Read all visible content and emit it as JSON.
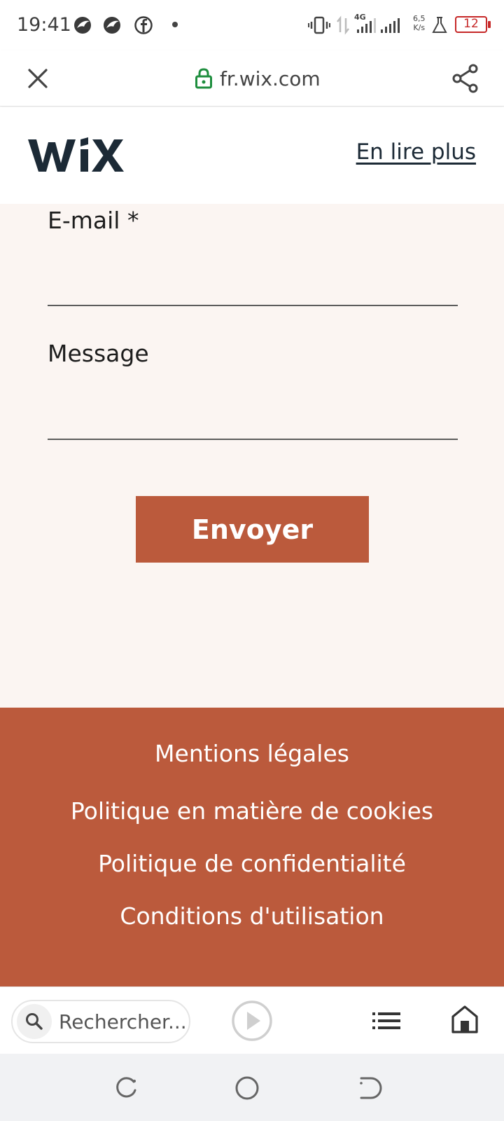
{
  "status_bar": {
    "time": "19:41",
    "speed_value": "6,5",
    "speed_unit": "K/s",
    "network": "4G",
    "battery": "12",
    "icons": [
      "bird-notification-icon",
      "bird-notification-icon",
      "facebook-icon",
      "vibrate-icon",
      "data-transfer-icon",
      "signal-icon",
      "signal-icon",
      "lab-flask-icon"
    ]
  },
  "browser": {
    "url": "fr.wix.com",
    "icons": [
      "close-icon",
      "lock-icon",
      "share-icon"
    ]
  },
  "header": {
    "logo": "WiX",
    "read_more": "En lire plus"
  },
  "form": {
    "email_label": "E-mail *",
    "email_value": "",
    "message_label": "Message",
    "message_value": "",
    "submit_label": "Envoyer"
  },
  "footer": {
    "links": [
      "Mentions légales",
      "Politique en matière de cookies",
      "Politique de confidentialité",
      "Conditions d'utilisation"
    ]
  },
  "bottom_bar": {
    "search_placeholder": "Rechercher...",
    "icons": [
      "search-icon",
      "play-icon",
      "list-icon",
      "home-icon"
    ]
  },
  "nav_bar": {
    "icons": [
      "recents-icon",
      "home-circle-icon",
      "back-icon"
    ]
  },
  "colors": {
    "accent": "#bb5a3c",
    "form_background": "#fbf5f2",
    "logo": "#1c2a36",
    "lock": "#1e8e3e",
    "battery": "#c62828"
  }
}
